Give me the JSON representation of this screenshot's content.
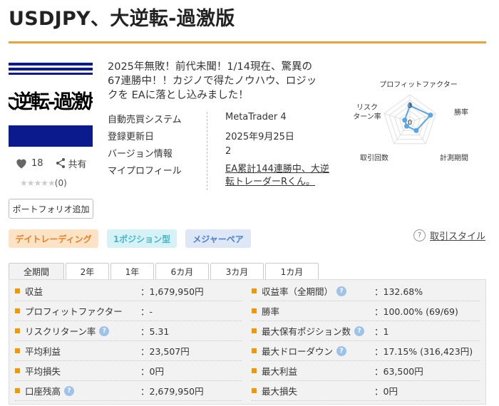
{
  "title": "USDJPY、大逆転-過激版",
  "thumbnail": {
    "text": "大逆転-過激版"
  },
  "social": {
    "likes": "18",
    "share_label": "共有",
    "rating_count": "(0)",
    "stars": "★★★★★"
  },
  "portfolio_button": "ポートフォリオ追加",
  "description": "2025年無敗！前代未聞！1/14現在、驚異の67連勝中！！カジノで得たノウハウ、ロジックを EAに落とし込みました！",
  "info": [
    {
      "key": "自動売買システム",
      "value": "MetaTrader 4"
    },
    {
      "key": "登録更新日",
      "value": "2025年9月25日"
    },
    {
      "key": "バージョン情報",
      "value": "2"
    },
    {
      "key": "マイプロフィール",
      "value": "EA累計144連勝中、大逆転トレーダーRくん。"
    }
  ],
  "radar": {
    "labels": [
      "プロフィットファクター",
      "勝率",
      "計測期間",
      "取引回数",
      "リスク",
      "ターン率"
    ],
    "scale_labels": [
      "3",
      "0"
    ],
    "axis_count": 5,
    "max": 5,
    "values": [
      3,
      4,
      2,
      1,
      1
    ]
  },
  "tags": [
    "デイトレーディング",
    "1ポジション型",
    "メジャーペア"
  ],
  "style_link": {
    "icon": "?",
    "label": "取引スタイル"
  },
  "tabs": [
    "全期間",
    "2年",
    "1年",
    "6カ月",
    "3カ月",
    "1カ月"
  ],
  "stats": [
    {
      "left": {
        "label": "収益",
        "value": "：1,679,950円",
        "help": false
      },
      "right": {
        "label": "収益率（全期間）",
        "value": "：132.68%",
        "help": true
      }
    },
    {
      "left": {
        "label": "プロフィットファクター",
        "value": "：-",
        "help": false
      },
      "right": {
        "label": "勝率",
        "value": "：100.00% (69/69)",
        "help": false
      }
    },
    {
      "left": {
        "label": "リスクリターン率",
        "value": "：5.31",
        "help": true
      },
      "right": {
        "label": "最大保有ポジション数",
        "value": "：1",
        "help": true
      }
    },
    {
      "left": {
        "label": "平均利益",
        "value": "：23,507円",
        "help": false
      },
      "right": {
        "label": "最大ドローダウン",
        "value": "：17.15% (316,423円)",
        "help": true
      }
    },
    {
      "left": {
        "label": "平均損失",
        "value": "：0円",
        "help": false
      },
      "right": {
        "label": "最大利益",
        "value": "：63,500円",
        "help": false
      }
    },
    {
      "left": {
        "label": "口座残高",
        "value": "：2,679,950円",
        "help": true
      },
      "right": {
        "label": "最大損失",
        "value": "：0円",
        "help": false
      }
    }
  ],
  "colors": {
    "accent": "#e8a33b",
    "bullet": "#f39800",
    "radar_line": "#5aa5e6",
    "thumb_blue": "#0b1a8c"
  }
}
